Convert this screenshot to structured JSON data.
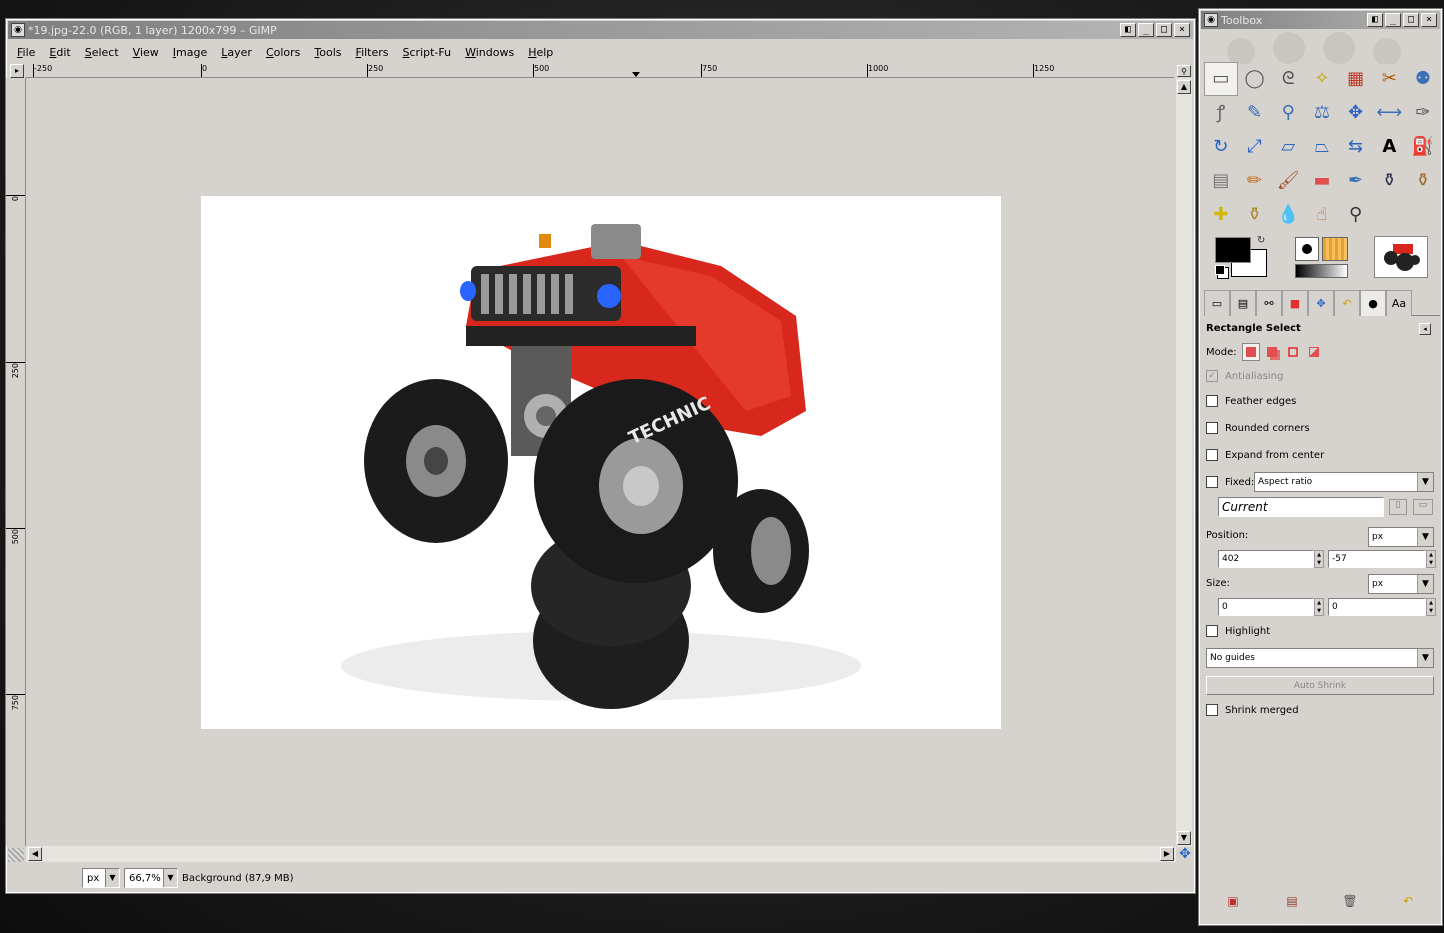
{
  "main_window": {
    "title": "*19.jpg-22.0 (RGB, 1 layer) 1200x799 – GIMP",
    "title_buttons": [
      "◧",
      "_",
      "□",
      "×"
    ],
    "menu": [
      "File",
      "Edit",
      "Select",
      "View",
      "Image",
      "Layer",
      "Colors",
      "Tools",
      "Filters",
      "Script-Fu",
      "Windows",
      "Help"
    ],
    "hruler_labels": [
      "-250",
      "0",
      "250",
      "500",
      "750",
      "1000",
      "1250"
    ],
    "vruler_labels": [
      "0",
      "250",
      "500",
      "750"
    ],
    "status": {
      "unit": "px",
      "zoom": "66,7%",
      "info": "Background (87,9 MB)"
    }
  },
  "toolbox": {
    "title": "Toolbox",
    "title_buttons": [
      "◧",
      "_",
      "□",
      "×"
    ],
    "tools": [
      "rect-select",
      "ellipse-select",
      "free-select",
      "fuzzy-select",
      "select-by-color",
      "scissors",
      "foreground-select",
      "paths",
      "color-picker",
      "zoom",
      "measure",
      "move",
      "align",
      "crop",
      "rotate",
      "scale",
      "shear",
      "perspective",
      "flip",
      "text",
      "bucket-fill",
      "blend",
      "pencil",
      "paintbrush",
      "eraser",
      "airbrush",
      "ink",
      "clone",
      "heal",
      "perspective-clone",
      "blur",
      "smudge",
      "dodge-burn"
    ],
    "tool_glyphs": [
      "▭",
      "◯",
      "ᘓ",
      "✧",
      "▦",
      "✂",
      "⚉",
      "ꝭ",
      "✎",
      "⚲",
      "⚖",
      "✥",
      "⟷",
      "✑",
      "↻",
      "⤢",
      "▱",
      "⏢",
      "⇆",
      "A",
      "⛽",
      "▤",
      "✏",
      "🖌",
      "▬",
      "✒",
      "⚱",
      "⚱",
      "✚",
      "⚱",
      "💧",
      "☝",
      "⚲"
    ],
    "tool_colors": [
      "#555",
      "#555",
      "#555",
      "#c9a100",
      "#c0392b",
      "#b35a00",
      "#3b6fb6",
      "#666",
      "#3b6fb6",
      "#3b6fb6",
      "#3b6fb6",
      "#2a64c5",
      "#3b6fb6",
      "#555",
      "#2a64c5",
      "#2a64c5",
      "#2a64c5",
      "#2a64c5",
      "#2a64c5",
      "#000",
      "#3b6fb6",
      "#777",
      "#c66a1a",
      "#a0522d",
      "#e05050",
      "#3b6fb6",
      "#335",
      "#a06a20",
      "#d4b800",
      "#b08a30",
      "#3b6fb6",
      "#c0662a",
      "#333"
    ],
    "selected_tool": "rect-select",
    "tabs": [
      "▭",
      "▤",
      "⚯",
      "■",
      "✥",
      "↶",
      "●",
      "Aa"
    ],
    "options": {
      "heading": "Rectangle Select",
      "mode_label": "Mode:",
      "antialiasing": "Antialiasing",
      "feather_edges": "Feather edges",
      "rounded_corners": "Rounded corners",
      "expand_from_center": "Expand from center",
      "fixed_label": "Fixed:",
      "fixed_value": "Aspect ratio",
      "fixed_entry": "Current",
      "position_label": "Position:",
      "position_unit": "px",
      "position_x": "402",
      "position_y": "-57",
      "size_label": "Size:",
      "size_unit": "px",
      "size_w": "0",
      "size_h": "0",
      "highlight": "Highlight",
      "guides": "No guides",
      "auto_shrink": "Auto Shrink",
      "shrink_merged": "Shrink merged"
    }
  }
}
